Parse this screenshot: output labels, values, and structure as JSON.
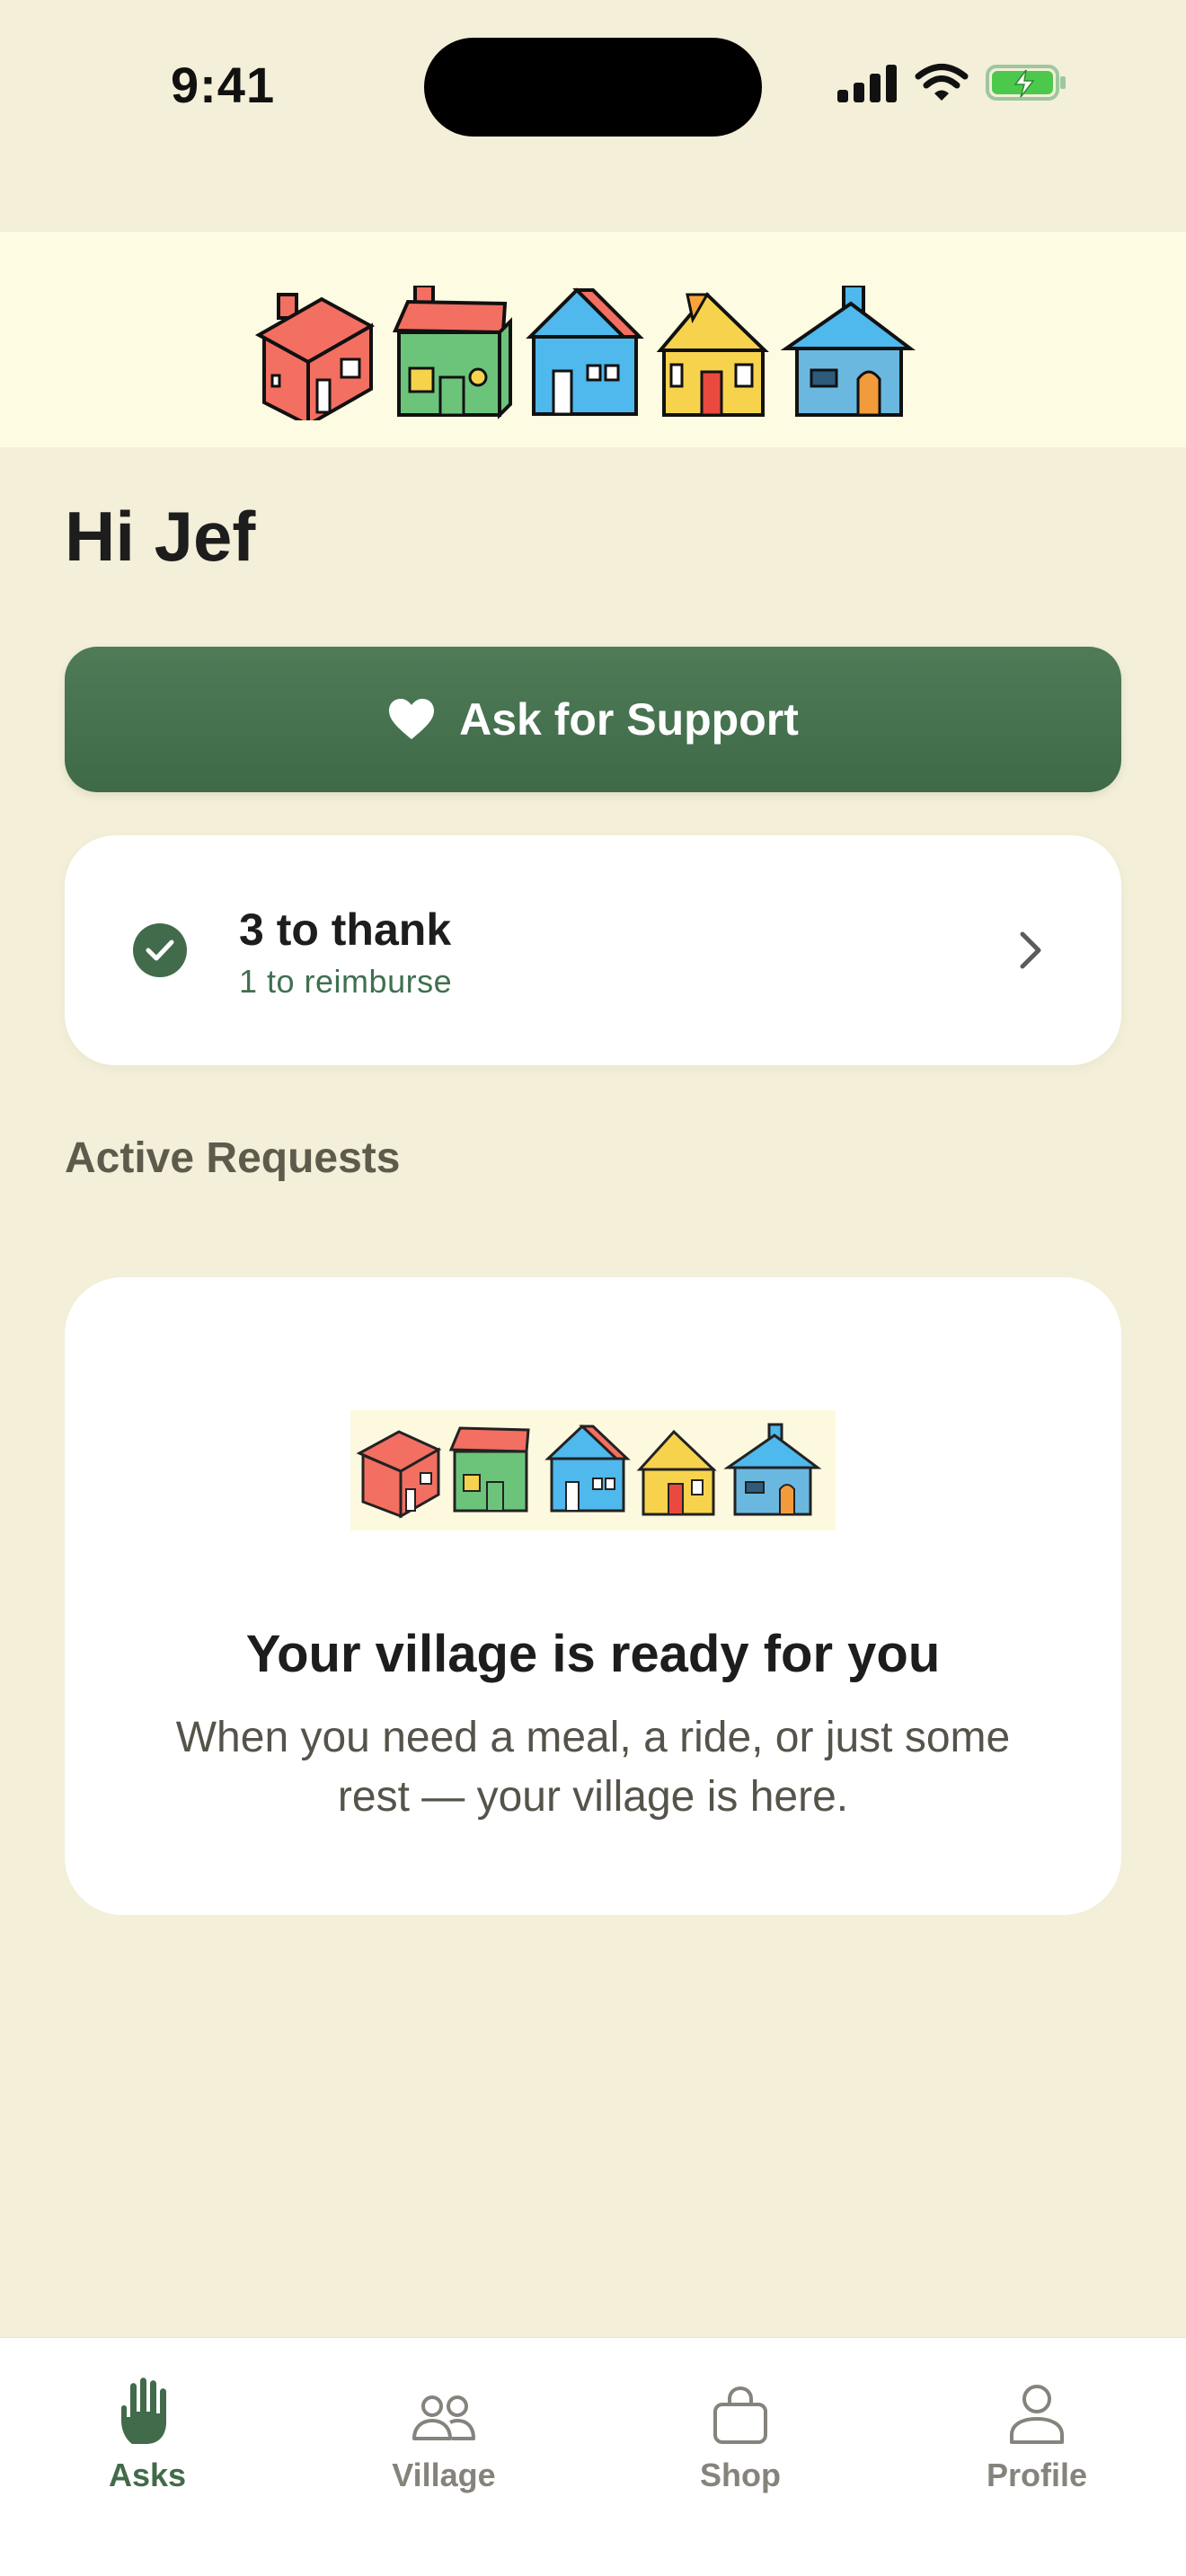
{
  "status_bar": {
    "time": "9:41"
  },
  "greeting": "Hi Jef",
  "ask_button": {
    "label": "Ask for Support",
    "icon": "heart-icon"
  },
  "thank_card": {
    "title": "3 to thank",
    "subtitle": "1 to reimburse",
    "icon": "check-circle-icon"
  },
  "active_requests": {
    "title": "Active Requests",
    "empty_state": {
      "title": "Your village is ready for you",
      "body": "When you need a meal, a ride, or just some rest — your village is here."
    }
  },
  "tab_bar": {
    "tabs": [
      {
        "label": "Asks",
        "icon": "hand-icon",
        "active": true
      },
      {
        "label": "Village",
        "icon": "people-icon",
        "active": false
      },
      {
        "label": "Shop",
        "icon": "bag-icon",
        "active": false
      },
      {
        "label": "Profile",
        "icon": "person-icon",
        "active": false
      }
    ]
  },
  "colors": {
    "background": "#f3efd8",
    "accent_green": "#416b4a",
    "banner": "#fdfbe2",
    "card": "#ffffff"
  }
}
